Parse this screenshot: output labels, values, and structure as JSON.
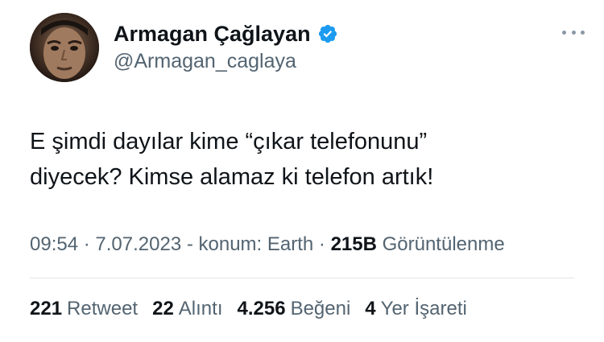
{
  "user": {
    "display_name": "Armagan Çağlayan",
    "username": "@Armagan_caglaya",
    "verified_color": "#1d9bf0"
  },
  "tweet": {
    "text_line1": "E şimdi dayılar kime “çıkar telefonunu”",
    "text_line2": "diyecek? Kimse alamaz ki telefon artık!"
  },
  "meta": {
    "time": "09:54",
    "sep1": " · ",
    "date": "7.07.2023",
    "sep2": " - ",
    "location": "konum: Earth",
    "sep3": " · ",
    "views_count": "215B",
    "views_label": " Görüntülenme"
  },
  "stats": [
    {
      "count": "221",
      "label": "Retweet"
    },
    {
      "count": "22",
      "label": "Alıntı"
    },
    {
      "count": "4.256",
      "label": "Beğeni"
    },
    {
      "count": "4",
      "label": "Yer İşareti"
    }
  ],
  "icons": {
    "avatar": "profile-photo",
    "verified": "verified-badge-icon",
    "more": "more-options-icon"
  }
}
